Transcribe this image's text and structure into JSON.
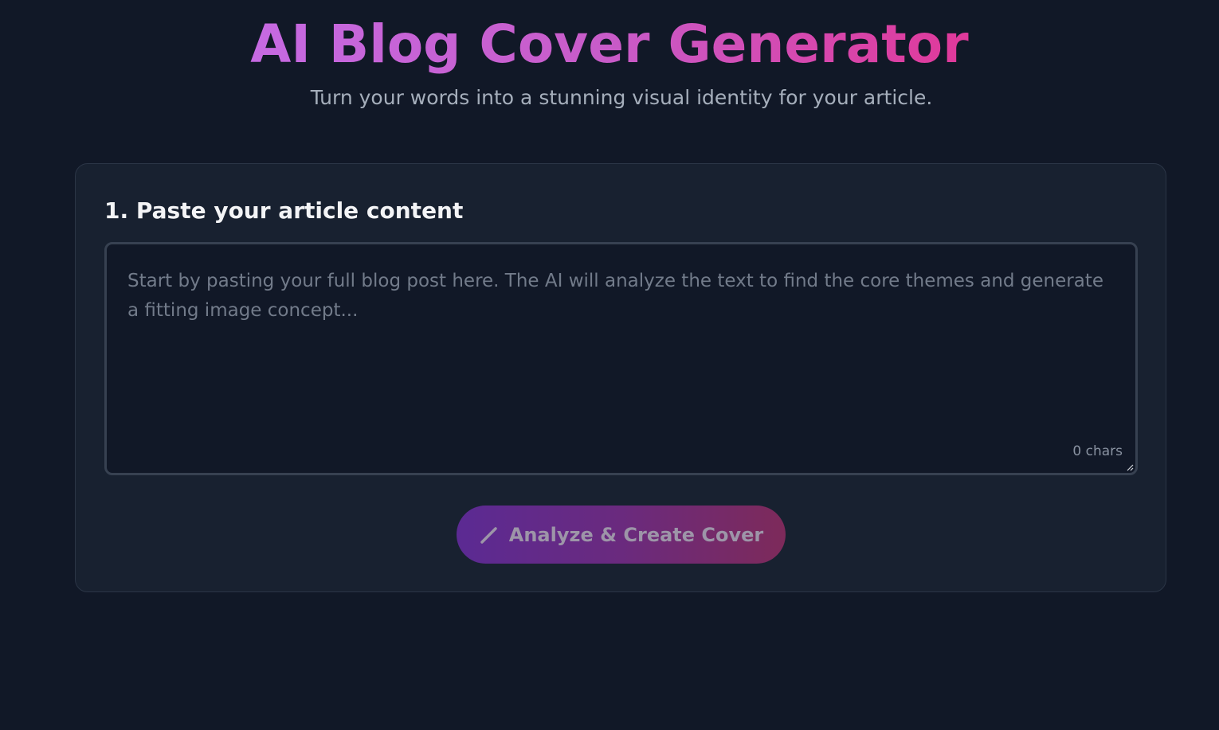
{
  "header": {
    "title": "AI Blog Cover Generator",
    "subtitle": "Turn your words into a stunning visual identity for your article."
  },
  "form": {
    "step_label": "1. Paste your article content",
    "textarea": {
      "value": "",
      "placeholder": "Start by pasting your full blog post here. The AI will analyze the text to find the core themes and generate a fitting image concept..."
    },
    "char_count": "0 chars",
    "submit_label": "Analyze & Create Cover",
    "submit_icon": "pencil-icon"
  },
  "colors": {
    "background": "#111827",
    "card": "#182130",
    "title_gradient_start": "#c66ae2",
    "title_gradient_end": "#e0399a",
    "button_gradient_start": "#5b2a93",
    "button_gradient_end": "#7d2a5a"
  }
}
